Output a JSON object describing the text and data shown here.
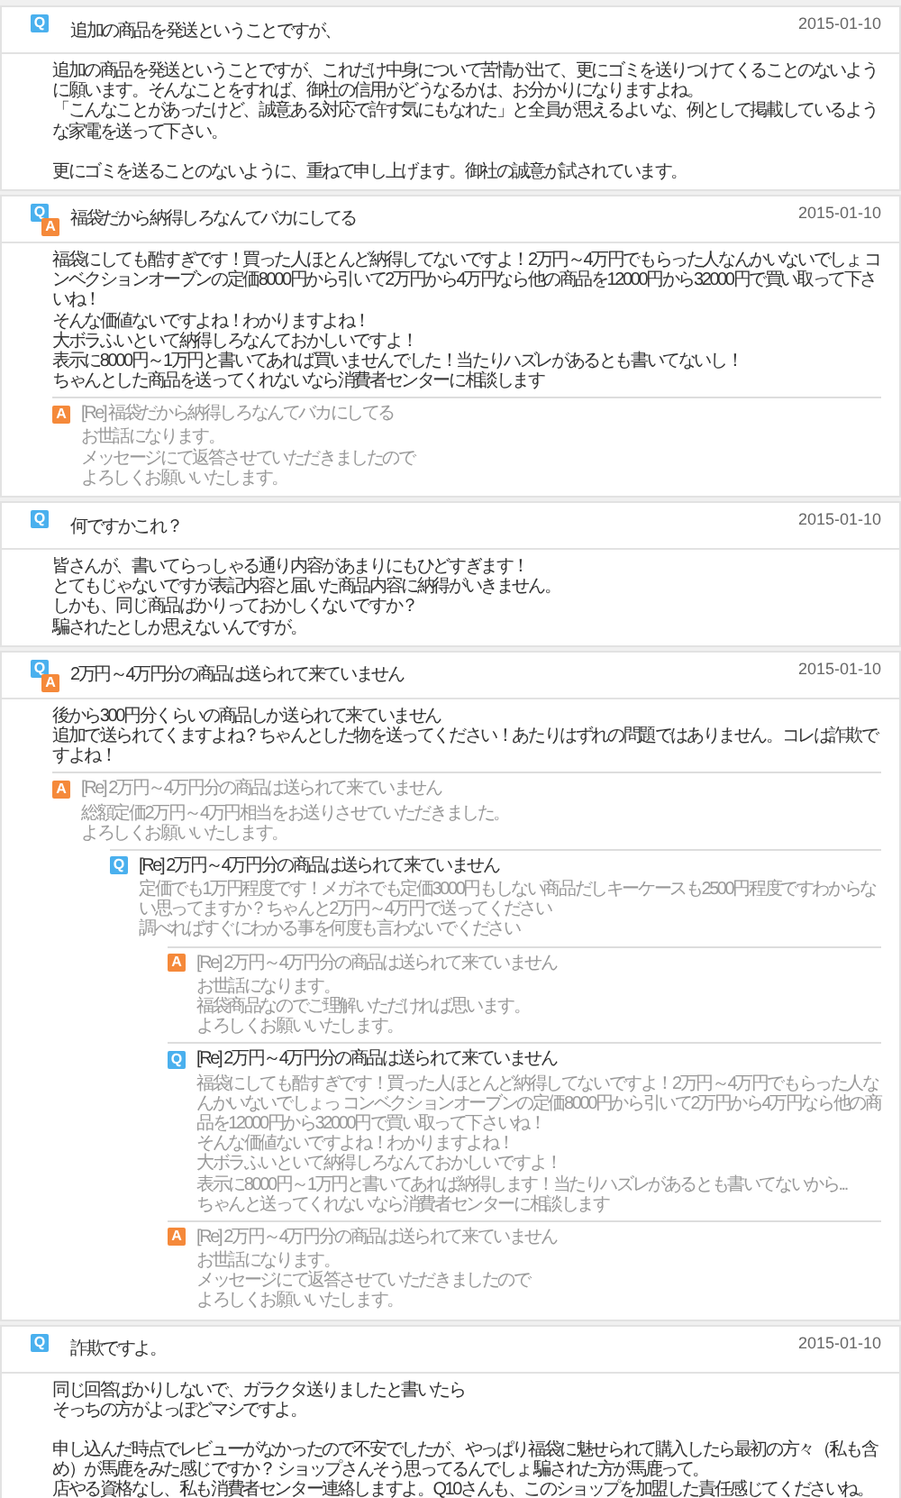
{
  "threads": [
    {
      "badges": [
        {
          "kind": "question",
          "label": "Q"
        }
      ],
      "title": "追加の商品を発送ということですが、",
      "date": "2015-01-10",
      "body": [
        [
          "追加の商品を発送ということですが、これだけ中身について苦情が出て、更にゴミを送りつけてくることのないように願います。そんなことをすれば、御社の信用がどうなるかは、お分かりになりますよね。",
          "「こんなことがあったけど、誠意ある対応で許す気にもなれた」と全員が思えるよいな、例として掲載しているような家電を送って下さい。"
        ],
        [
          "更にゴミを送ることのないように、重ねて申し上げます。御社の誠意が試されています。"
        ]
      ]
    },
    {
      "badges": [
        {
          "kind": "question",
          "label": "Q"
        },
        {
          "kind": "answer",
          "label": "A"
        }
      ],
      "title": "福袋だから納得しろなんてバカにしてる",
      "date": "2015-01-10",
      "body": [
        [
          "福袋にしても酷すぎです！買った人ほとんど納得してないですよ！2万円～4万円でもらった人なんかいないでしょ コンベクションオーブンの定価8000円から引いて2万円から4万円なら他の商品を12000円から32000円で買い取って下さいね！",
          "そんな価値ないですよね！わかりますよね！",
          "大ボラふいといて納得しろなんておかしいですよ！",
          "表示に8000円～1万円と書いてあれば買いませんでした！当たりハズレがあるとも書いてないし！",
          "ちゃんとした商品を送ってくれないなら消費者センターに相談します"
        ]
      ],
      "replies": [
        {
          "kind": "answer",
          "label": "A",
          "title": "[Re] 福袋だから納得しろなんてバカにしてる",
          "body": [
            [
              "お世話になります。",
              "メッセージにて返答させていただきましたので",
              "よろしくお願いいたします。"
            ]
          ]
        }
      ]
    },
    {
      "badges": [
        {
          "kind": "question",
          "label": "Q"
        }
      ],
      "title": "何ですかこれ？",
      "date": "2015-01-10",
      "body": [
        [
          "皆さんが、書いてらっしゃる通り内容があまりにもひどすぎます！",
          "とてもじゃないですが表記内容と届いた商品内容に納得がいきません。",
          "しかも、同じ商品ばかりっておかしくないですか？",
          "騙されたとしか思えないんですが。"
        ]
      ]
    },
    {
      "badges": [
        {
          "kind": "question",
          "label": "Q"
        },
        {
          "kind": "answer",
          "label": "A"
        }
      ],
      "title": "2万円～4万円分の商品は送られて来ていません",
      "date": "2015-01-10",
      "body": [
        [
          "後から300円分くらいの商品しか送られて来ていません",
          "追加で送られてくますよね？ちゃんとした物を送ってください！あたりはずれの問題ではありません。コレは詐欺ですよね！"
        ]
      ],
      "replies": [
        {
          "kind": "answer",
          "label": "A",
          "title": "[Re] 2万円～4万円分の商品は送られて来ていません",
          "body": [
            [
              "総額定価2万円～4万円相当をお送りさせていただきました。",
              "よろしくお願いいたします。"
            ]
          ],
          "children": [
            {
              "kind": "question",
              "label": "Q",
              "title": "[Re] 2万円～4万円分の商品は送られて来ていません",
              "body": [
                [
                  "定価でも1万円程度です！メガネでも定価3000円もしない商品だしキーケースも2500円程度ですわからない思ってますか？ちゃんと2万円～4万円で送ってください",
                  "調べればすぐにわかる事を何度も言わないでください"
                ]
              ],
              "children": [
                {
                  "kind": "answer",
                  "label": "A",
                  "title": "[Re] 2万円～4万円分の商品は送られて来ていません",
                  "body": [
                    [
                      "お世話になります。",
                      "福袋商品なのでご理解いただければ思います。",
                      "よろしくお願いいたします。"
                    ]
                  ]
                },
                {
                  "kind": "question",
                  "label": "Q",
                  "title": "[Re] 2万円～4万円分の商品は送られて来ていません",
                  "body": [
                    [
                      "福袋にしても酷すぎです！買った人ほとんど納得してないですよ！2万円～4万円でもらった人なんかいないでしょっ コンベクションオーブンの定価8000円から引いて2万円から4万円なら他の商品を12000円から32000円で買い取って下さいね！",
                      "そんな価値ないですよね！わかりますよね！",
                      "大ボラふいといて納得しろなんておかしいですよ！",
                      "表示に8000円～1万円と書いてあれば納得します！当たりハズレがあるとも書いてないから...",
                      "ちゃんと送ってくれないなら消費者センターに相談します"
                    ]
                  ]
                },
                {
                  "kind": "answer",
                  "label": "A",
                  "title": "[Re] 2万円～4万円分の商品は送られて来ていません",
                  "body": [
                    [
                      "お世話になります。",
                      "メッセージにて返答させていただきましたので",
                      "よろしくお願いいたします。"
                    ]
                  ]
                }
              ]
            }
          ]
        }
      ]
    },
    {
      "badges": [
        {
          "kind": "question",
          "label": "Q"
        }
      ],
      "title": "詐欺ですよ。",
      "date": "2015-01-10",
      "body": [
        [
          "同じ回答ばかりしないで、ガラクタ送りましたと書いたら",
          "そっちの方がよっぽどマシですよ。"
        ],
        [
          "申し込んだ時点でレビューがなかったので不安でしたが、やっぱり福袋に魅せられて購入したら最初の方々（私も含め）が馬鹿をみた感じですか？ ショップさんそう思ってるんでしょ 騙された方が馬鹿って。",
          "店やる資格なし、私も消費者センター連絡しますよ。Q10さんも、このショップを加盟した責任感じてくださいね。"
        ]
      ]
    }
  ]
}
